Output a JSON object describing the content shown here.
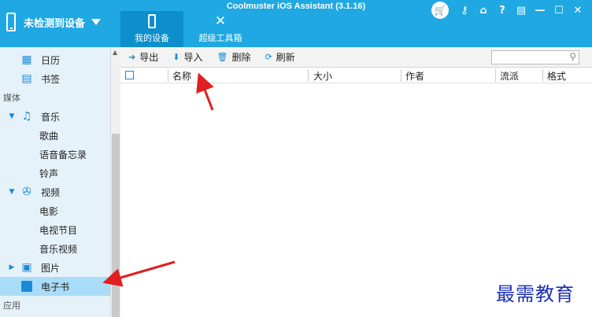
{
  "app": {
    "title": "Coolmuster iOS Assistant (3.1.16)"
  },
  "device": {
    "label": "未检测到设备"
  },
  "topnav": [
    {
      "label": "我的设备",
      "active": true
    },
    {
      "label": "超级工具箱",
      "active": false
    }
  ],
  "sidebar": {
    "items": [
      {
        "label": "日历",
        "icon": "calendar-icon"
      },
      {
        "label": "书签",
        "icon": "bookmark-icon"
      }
    ],
    "group_media": "媒体",
    "music": {
      "label": "音乐",
      "children": [
        "歌曲",
        "语音备忘录",
        "铃声"
      ]
    },
    "video": {
      "label": "视频",
      "children": [
        "电影",
        "电视节目",
        "音乐视频"
      ]
    },
    "photos": {
      "label": "图片"
    },
    "ebooks": {
      "label": "电子书",
      "selected": true
    },
    "group_apps": "应用"
  },
  "toolbar": {
    "export_label": "导出",
    "import_label": "导入",
    "delete_label": "删除",
    "refresh_label": "刷新",
    "search_value": ""
  },
  "table": {
    "columns": [
      "名称",
      "大小",
      "作者",
      "流派",
      "格式"
    ],
    "rows": []
  },
  "watermark": "最需教育",
  "colors": {
    "accent": "#1fa8e2",
    "selected": "#a9dcf7",
    "arrow": "#e02020"
  }
}
